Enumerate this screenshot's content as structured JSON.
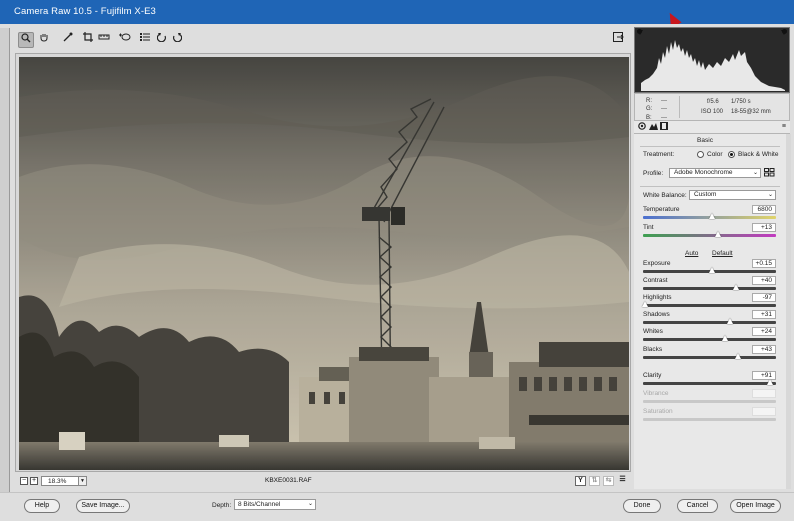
{
  "window": {
    "title": "Camera Raw 10.5  -  Fujifilm X-E3"
  },
  "toolbar": {
    "tools": [
      {
        "name": "zoom-tool",
        "glyph": "🔍"
      },
      {
        "name": "hand-tool",
        "glyph": "✋"
      },
      {
        "name": "white-balance-tool",
        "glyph": "✎"
      },
      {
        "name": "crop-tool",
        "glyph": "⌗"
      },
      {
        "name": "straighten-tool",
        "glyph": "▭"
      },
      {
        "name": "spot-removal-tool",
        "glyph": "⊕"
      },
      {
        "name": "preferences-tool",
        "glyph": "☰"
      },
      {
        "name": "rotate-left-tool",
        "glyph": "↺"
      },
      {
        "name": "rotate-right-tool",
        "glyph": "↻"
      }
    ],
    "fullscreen_glyph": "⇥"
  },
  "statusbar": {
    "zoom_value": "18.3%",
    "filename": "KBXE0031.RAF",
    "minus": "−",
    "plus": "+",
    "y_label": "Y"
  },
  "info": {
    "r_label": "R:",
    "g_label": "G:",
    "b_label": "B:",
    "r_value": "---",
    "g_value": "---",
    "b_value": "---",
    "aperture": "f/5.6",
    "shutter": "1/750 s",
    "iso": "ISO 100",
    "lens": "18-55@32 mm"
  },
  "panel": {
    "section_title": "Basic",
    "treatment_label": "Treatment:",
    "treatment_color": "Color",
    "treatment_bw": "Black & White",
    "profile_label": "Profile:",
    "profile_value": "Adobe Monochrome",
    "wb_label": "White Balance:",
    "wb_value": "Custom",
    "auto_label": "Auto",
    "default_label": "Default",
    "sliders": [
      {
        "key": "temperature",
        "label": "Temperature",
        "value": "6800",
        "position": 0.52
      },
      {
        "key": "tint",
        "label": "Tint",
        "value": "+13",
        "position": 0.57
      },
      {
        "key": "exposure",
        "label": "Exposure",
        "value": "+0.15",
        "position": 0.52
      },
      {
        "key": "contrast",
        "label": "Contrast",
        "value": "+40",
        "position": 0.7
      },
      {
        "key": "highlights",
        "label": "Highlights",
        "value": "-97",
        "position": 0.02
      },
      {
        "key": "shadows",
        "label": "Shadows",
        "value": "+31",
        "position": 0.66
      },
      {
        "key": "whites",
        "label": "Whites",
        "value": "+24",
        "position": 0.62
      },
      {
        "key": "blacks",
        "label": "Blacks",
        "value": "+43",
        "position": 0.72
      },
      {
        "key": "clarity",
        "label": "Clarity",
        "value": "+91",
        "position": 0.96
      },
      {
        "key": "vibrance",
        "label": "Vibrance",
        "value": "",
        "position": null
      },
      {
        "key": "saturation",
        "label": "Saturation",
        "value": "",
        "position": null
      }
    ]
  },
  "footer": {
    "help": "Help",
    "save": "Save Image...",
    "depth_label": "Depth:",
    "depth_value": "8 Bits/Channel",
    "done": "Done",
    "cancel": "Cancel",
    "open": "Open Image"
  },
  "colors": {
    "titlebar": "#1f65b6",
    "cursor": "#c8161d",
    "photo_tint": "#cfc6b2"
  }
}
